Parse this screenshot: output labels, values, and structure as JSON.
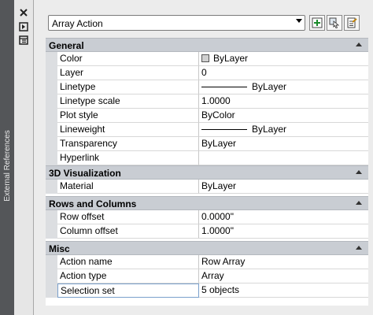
{
  "side_panel": {
    "title": "External References"
  },
  "toolbar": {
    "close_glyph": "✕",
    "icons": [
      "close-icon",
      "autohide-icon",
      "properties-menu-icon"
    ]
  },
  "selector": {
    "value": "Array Action",
    "buttons": [
      "toggle-pickadd-icon",
      "select-objects-icon",
      "quick-select-icon"
    ]
  },
  "sections": [
    {
      "title": "General",
      "rows": [
        {
          "name": "Color",
          "value": "ByLayer"
        },
        {
          "name": "Layer",
          "value": "0"
        },
        {
          "name": "Linetype",
          "value": "ByLayer"
        },
        {
          "name": "Linetype scale",
          "value": "1.0000"
        },
        {
          "name": "Plot style",
          "value": "ByColor"
        },
        {
          "name": "Lineweight",
          "value": "ByLayer"
        },
        {
          "name": "Transparency",
          "value": "ByLayer"
        },
        {
          "name": "Hyperlink",
          "value": ""
        }
      ]
    },
    {
      "title": "3D Visualization",
      "rows": [
        {
          "name": "Material",
          "value": "ByLayer"
        }
      ]
    },
    {
      "title": "Rows and Columns",
      "rows": [
        {
          "name": "Row offset",
          "value": "0.0000\""
        },
        {
          "name": "Column offset",
          "value": "1.0000\""
        }
      ]
    },
    {
      "title": "Misc",
      "rows": [
        {
          "name": "Action name",
          "value": "Row Array"
        },
        {
          "name": "Action type",
          "value": "Array"
        },
        {
          "name": "Selection set",
          "value": "5 objects"
        }
      ]
    }
  ],
  "colors": {
    "section_header": "#c9cdd3",
    "panel": "#ececec",
    "frame": "#6b6e72"
  }
}
